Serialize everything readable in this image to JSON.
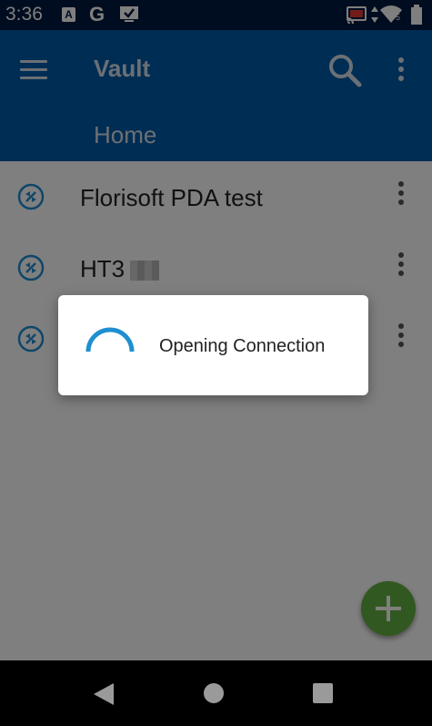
{
  "status_bar": {
    "time": "3:36",
    "left_icons": [
      "a-app-icon",
      "google-icon",
      "checkbox-app-icon"
    ],
    "right_icons": [
      "cast-icon",
      "data-arrows-icon",
      "wifi-icon",
      "signal-icon",
      "battery-icon"
    ],
    "signal_label": "5",
    "google_glyph": "G",
    "a_glyph": "A"
  },
  "app_bar": {
    "title": "Vault",
    "breadcrumb": "Home",
    "color": "#005ba8"
  },
  "connections": [
    {
      "label": "Florisoft PDA test",
      "icon": "remote-desktop-icon"
    },
    {
      "label": "HT3",
      "icon": "remote-desktop-icon"
    },
    {
      "label": "",
      "icon": "remote-desktop-icon"
    }
  ],
  "dialog": {
    "message": "Opening Connection",
    "spinner_color": "#1f8fd0"
  },
  "fab": {
    "icon": "plus-icon",
    "color": "#64b043"
  },
  "nav_bar": {
    "buttons": [
      "back-icon",
      "home-icon",
      "recents-icon"
    ]
  }
}
